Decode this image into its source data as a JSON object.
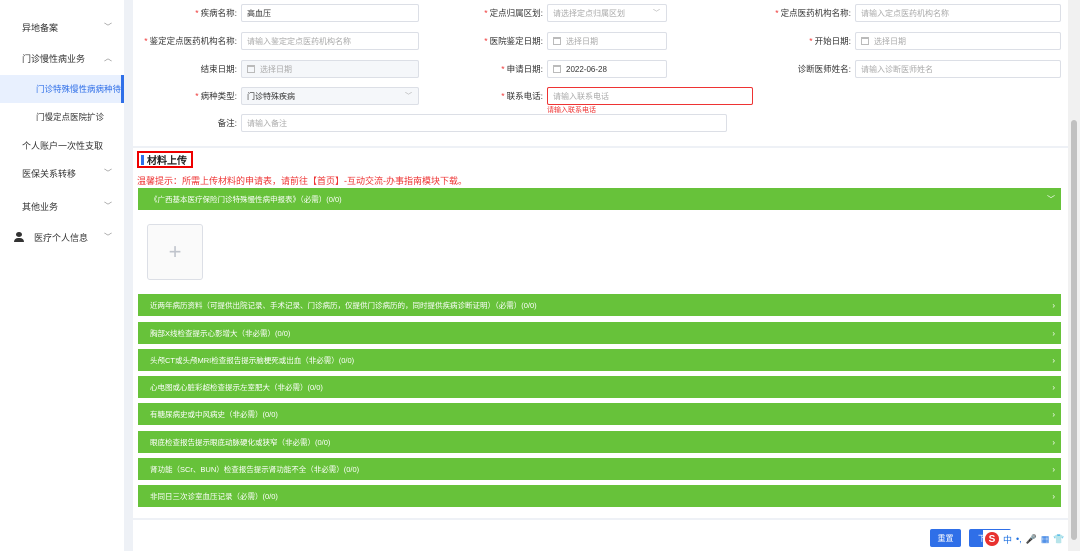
{
  "sidebar": {
    "items": [
      {
        "label": "异地备案",
        "chevron": "﹀"
      },
      {
        "label": "门诊慢性病业务",
        "chevron": "︿"
      },
      {
        "label": "门诊特殊慢性病病种待遇"
      },
      {
        "label": "门慢定点医院扩诊"
      },
      {
        "label": "个人账户一次性支取"
      },
      {
        "label": "医保关系转移",
        "chevron": "﹀"
      },
      {
        "label": "其他业务",
        "chevron": "﹀"
      },
      {
        "label": "医疗个人信息",
        "chevron": "﹀"
      }
    ]
  },
  "form": {
    "disease_name": {
      "label": "疾病名称",
      "value": "高血压"
    },
    "designated_area": {
      "label": "定点归属区划",
      "placeholder": "请选择定点归属区划"
    },
    "designated_org": {
      "label": "定点医药机构名称",
      "placeholder": "请输入定点医药机构名称"
    },
    "appraisal_org": {
      "label": "鉴定定点医药机构名称",
      "placeholder": "请输入鉴定定点医药机构名称"
    },
    "appraisal_date": {
      "label": "医院鉴定日期",
      "placeholder": "选择日期"
    },
    "start_date": {
      "label": "开始日期",
      "placeholder": "选择日期"
    },
    "end_date": {
      "label": "结束日期",
      "placeholder": "选择日期"
    },
    "apply_date": {
      "label": "申请日期",
      "value": "2022-06-28"
    },
    "doctor_name": {
      "label": "诊断医师姓名",
      "placeholder": "请输入诊断医师姓名"
    },
    "disease_type": {
      "label": "病种类型",
      "value": "门诊特殊疾病"
    },
    "phone": {
      "label": "联系电话",
      "placeholder": "请输入联系电话",
      "error": "请输入联系电话"
    },
    "remark": {
      "label": "备注",
      "placeholder": "请输入备注"
    }
  },
  "materials": {
    "title": "材料上传",
    "tip": "温馨提示：所需上传材料的申请表，请前往【首页】-互动交流-办事指南模块下载。",
    "upload_plus": "+",
    "items": [
      "《广西基本医疗保险门诊特殊慢性病申报表》（必需）(0/0)",
      "近两年病历资料（可提供出院记录、手术记录、门诊病历，仅提供门诊病历的，同时提供疾病诊断证明）（必需）(0/0)",
      "胸部X线检查提示心影增大（非必需）(0/0)",
      "头颅CT或头颅MRI检查报告提示脑梗死或出血（非必需）(0/0)",
      "心电图或心脏彩超检查提示左室肥大（非必需）(0/0)",
      "有糖尿病史或中风病史（非必需）(0/0)",
      "眼底检查报告提示眼底动脉硬化或狭窄（非必需）(0/0)",
      "肾功能（SCr、BUN）检查报告提示肾功能不全（非必需）(0/0)",
      "非同日三次诊室血压记录（必需）(0/0)"
    ]
  },
  "buttons": {
    "reset": "重置",
    "next": "下一步"
  },
  "ime": {
    "logo": "S",
    "lang": "中",
    "dot": "•,",
    "mic": "🎤",
    "grid": "▦",
    "shirt": "👕",
    "menu": "⠿"
  }
}
